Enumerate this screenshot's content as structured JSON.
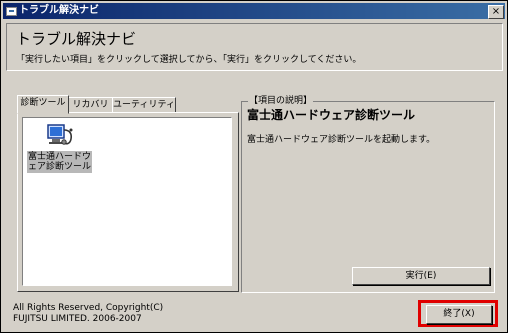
{
  "window": {
    "title": "トラブル解決ナビ",
    "close_glyph": "×"
  },
  "header": {
    "title": "トラブル解決ナビ",
    "instruction": "「実行したい項目」をクリックして選択してから、「実行」をクリックしてください。"
  },
  "tabs": [
    {
      "label": "診断ツール",
      "active": true
    },
    {
      "label": "リカバリ",
      "active": false
    },
    {
      "label": "ユーティリティ",
      "active": false
    }
  ],
  "tools": [
    {
      "label_line1": "富士通ハードウ",
      "label_line2": "ェア診断ツール",
      "icon": "computer-stethoscope-icon"
    }
  ],
  "description": {
    "legend": "【項目の説明】",
    "title": "富士通ハードウェア診断ツール",
    "text": "富士通ハードウェア診断ツールを起動します。",
    "run_label": "実行(E)"
  },
  "footer": {
    "copyright_line1": "All Rights Reserved, Copyright(C)",
    "copyright_line2": "FUJITSU LIMITED. 2006-2007",
    "end_label": "終了(X)"
  },
  "colors": {
    "titlebar": "#0a246a",
    "face": "#d4d0c8",
    "highlight": "#e00000"
  }
}
